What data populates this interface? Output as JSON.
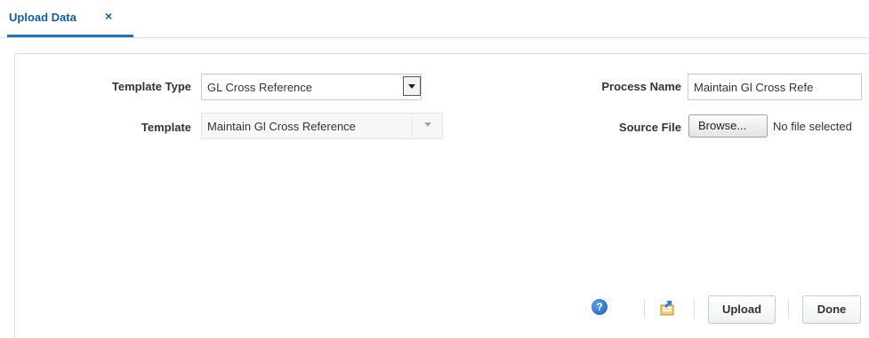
{
  "tab": {
    "label": "Upload Data",
    "close_glyph": "×"
  },
  "form": {
    "template_type": {
      "label": "Template Type",
      "value": "GL Cross Reference"
    },
    "template": {
      "label": "Template",
      "value": "Maintain Gl Cross Reference"
    },
    "process_name": {
      "label": "Process Name",
      "value": "Maintain Gl Cross Refe"
    },
    "source_file": {
      "label": "Source File",
      "browse_label": "Browse...",
      "status": "No file selected"
    }
  },
  "actions": {
    "help_glyph": "?",
    "upload_label": "Upload",
    "done_label": "Done"
  },
  "icons": [
    "help-icon",
    "export-icon",
    "close-icon",
    "dropdown-arrow-icon"
  ],
  "colors": {
    "accent": "#145c9e",
    "tab_underline": "#2c6fb2"
  }
}
